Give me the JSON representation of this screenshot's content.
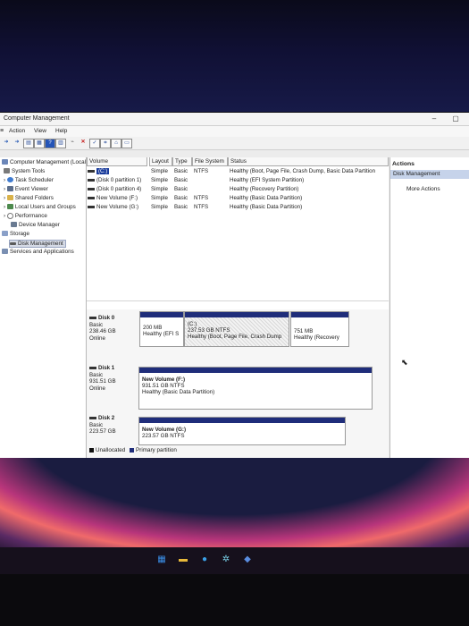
{
  "window": {
    "title": "Computer Management",
    "minimize": "–",
    "maximize": "▢"
  },
  "menu": [
    "Action",
    "View",
    "Help"
  ],
  "tree": {
    "root": "Computer Management (Local",
    "system_tools": "System Tools",
    "task_scheduler": "Task Scheduler",
    "event_viewer": "Event Viewer",
    "shared_folders": "Shared Folders",
    "local_users": "Local Users and Groups",
    "performance": "Performance",
    "device_manager": "Device Manager",
    "storage": "Storage",
    "disk_management": "Disk Management",
    "services": "Services and Applications"
  },
  "volume_table": {
    "headers": [
      "Volume",
      "Layout",
      "Type",
      "File System",
      "Status"
    ],
    "rows": [
      {
        "volume": "(C:)",
        "layout": "Simple",
        "type": "Basic",
        "fs": "NTFS",
        "status": "Healthy (Boot, Page File, Crash Dump, Basic Data Partition"
      },
      {
        "volume": "(Disk 0 partition 1)",
        "layout": "Simple",
        "type": "Basic",
        "fs": "",
        "status": "Healthy (EFI System Partition)"
      },
      {
        "volume": "(Disk 0 partition 4)",
        "layout": "Simple",
        "type": "Basic",
        "fs": "",
        "status": "Healthy (Recovery Partition)"
      },
      {
        "volume": "New Volume (F:)",
        "layout": "Simple",
        "type": "Basic",
        "fs": "NTFS",
        "status": "Healthy (Basic Data Partition)"
      },
      {
        "volume": "New Volume (G:)",
        "layout": "Simple",
        "type": "Basic",
        "fs": "NTFS",
        "status": "Healthy (Basic Data Partition)"
      }
    ]
  },
  "disks": {
    "disk0": {
      "name": "Disk 0",
      "type": "Basic",
      "size": "238.46 GB",
      "state": "Online",
      "p1": {
        "size": "200 MB",
        "status": "Healthy (EFI S"
      },
      "p2": {
        "label": "(C:)",
        "size": "237.53 GB NTFS",
        "status": "Healthy (Boot, Page File, Crash Dump"
      },
      "p3": {
        "size": "751 MB",
        "status": "Healthy (Recovery"
      }
    },
    "disk1": {
      "name": "Disk 1",
      "type": "Basic",
      "size": "931.51 GB",
      "state": "Online",
      "p1": {
        "label": "New Volume (F:)",
        "size": "931.51 GB NTFS",
        "status": "Healthy (Basic Data Partition)"
      }
    },
    "disk2": {
      "name": "Disk 2",
      "type": "Basic",
      "size": "223.57 GB",
      "p1": {
        "label": "New Volume (G:)",
        "size": "223.57 GB NTFS"
      }
    }
  },
  "legend": {
    "unallocated": "Unallocated",
    "primary": "Primary partition",
    "unallocated_color": "#111111",
    "primary_color": "#1f2d7a"
  },
  "actions": {
    "header": "Actions",
    "section": "Disk Management",
    "more": "More Actions"
  },
  "taskbar": [
    "windows-icon",
    "file-explorer-icon",
    "chrome-icon",
    "settings-icon",
    "app-icon"
  ]
}
